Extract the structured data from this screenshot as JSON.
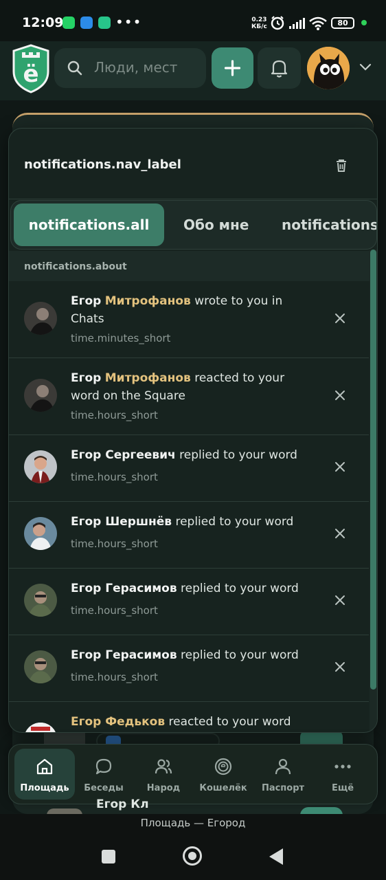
{
  "status_bar": {
    "time": "12:09",
    "speed_value": "0.23",
    "speed_unit": "КБ/с",
    "battery": "80",
    "dots": "•••"
  },
  "header": {
    "logo_letter": "ё",
    "search_placeholder": "Люди, мест"
  },
  "panel": {
    "title": "notifications.nav_label",
    "tabs": [
      {
        "label": "notifications.all",
        "active": true
      },
      {
        "label": "Обо мне",
        "active": false
      },
      {
        "label": "notifications",
        "active": false
      }
    ],
    "section_label": "notifications.about",
    "items": [
      {
        "first": "Егор",
        "last": "Митрофанов",
        "action": "wrote to you in Chats",
        "time": "time.minutes_short"
      },
      {
        "first": "Егор",
        "last": "Митрофанов",
        "action": "reacted to your word on the Square",
        "time": "time.hours_short"
      },
      {
        "name": "Егор Сергеевич",
        "action": "replied to your word",
        "time": "time.hours_short"
      },
      {
        "name": "Егор Шершнёв",
        "action": "replied to your word",
        "time": "time.hours_short"
      },
      {
        "name": "Егор Герасимов",
        "action": "replied to your word",
        "time": "time.hours_short"
      },
      {
        "name": "Егор Герасимов",
        "action": "replied to your word",
        "time": "time.hours_short"
      },
      {
        "name": "Егор Федьков",
        "action": "reacted to your word"
      }
    ]
  },
  "background": {
    "partial_name": "Егор Кл"
  },
  "bottom_nav": [
    {
      "label": "Площадь",
      "active": true
    },
    {
      "label": "Беседы",
      "active": false
    },
    {
      "label": "Народ",
      "active": false
    },
    {
      "label": "Кошелёк",
      "active": false
    },
    {
      "label": "Паспорт",
      "active": false
    },
    {
      "label": "Ещё",
      "active": false
    }
  ],
  "system": {
    "page_title": "Площадь — Егород"
  },
  "colors": {
    "accent": "#3d8a73",
    "highlight_name": "#e3c27e",
    "background": "#101816"
  }
}
